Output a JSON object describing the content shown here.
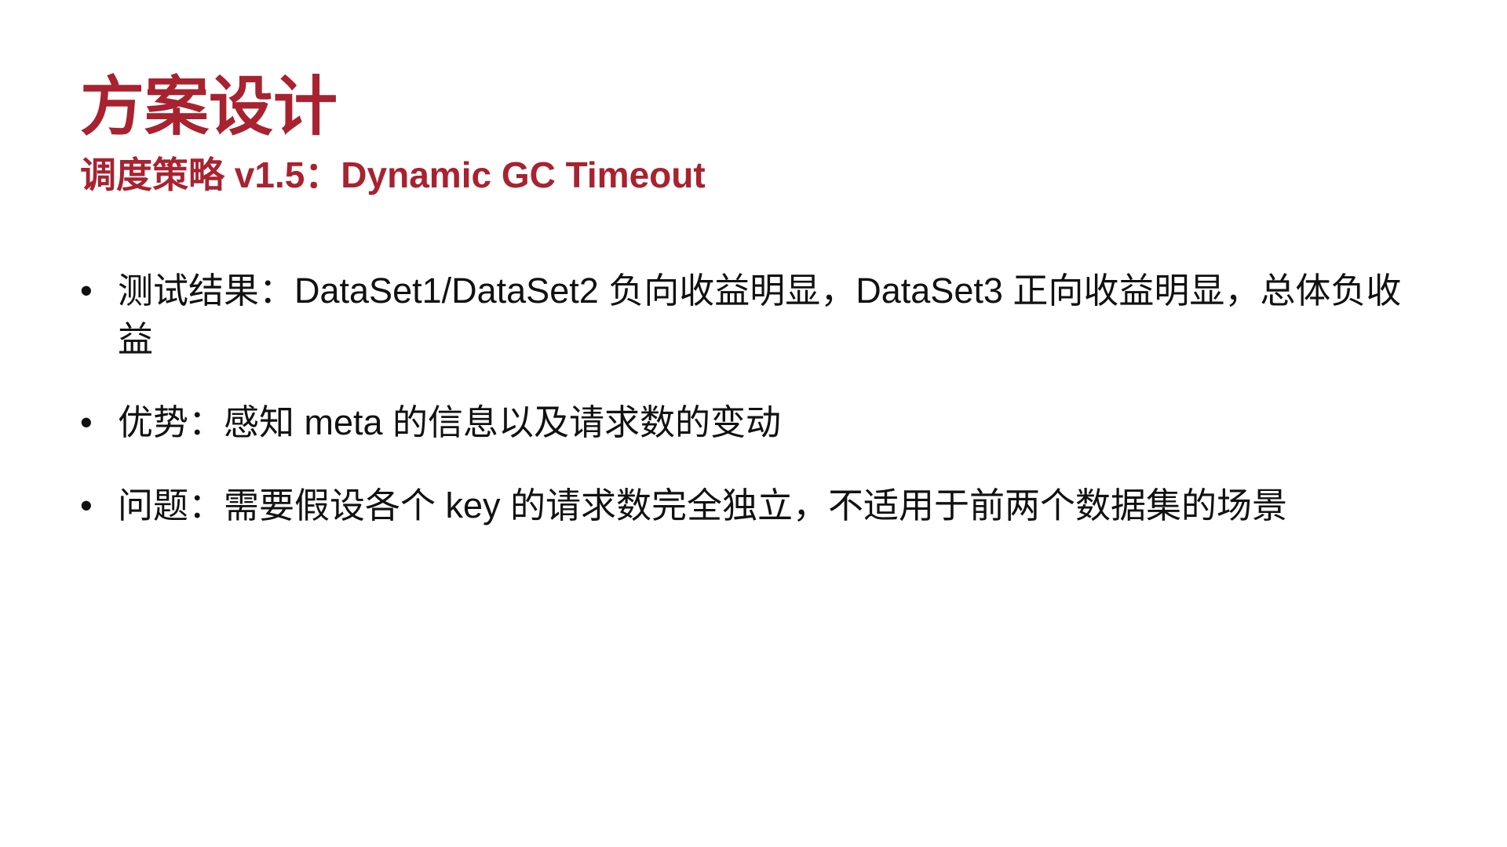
{
  "colors": {
    "accent": "#a82230",
    "body_text": "#111111",
    "background": "#ffffff"
  },
  "slide": {
    "title": "方案设计",
    "subtitle": "调度策略 v1.5：Dynamic GC Timeout",
    "bullet_symbol": "•",
    "bullets": [
      {
        "text": "测试结果：DataSet1/DataSet2 负向收益明显，DataSet3 正向收益明显，总体负收益"
      },
      {
        "text": "优势：感知 meta 的信息以及请求数的变动"
      },
      {
        "text": "问题：需要假设各个 key 的请求数完全独立，不适用于前两个数据集的场景"
      }
    ]
  }
}
